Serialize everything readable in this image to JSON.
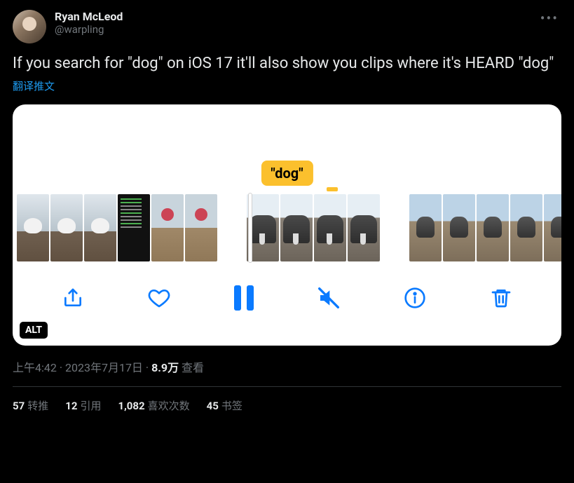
{
  "author": {
    "display_name": "Ryan McLeod",
    "handle": "@warpling"
  },
  "tweet_text": "If you search for \"dog\" on iOS 17 it'll also show you clips where it's HEARD \"dog\"",
  "translate_label": "翻译推文",
  "media": {
    "search_term_label": "\"dog\"",
    "alt_badge": "ALT"
  },
  "meta": {
    "time": "上午4:42",
    "date": "2023年7月17日",
    "views_count": "8.9万",
    "views_label": "查看"
  },
  "stats": {
    "retweets_count": "57",
    "retweets_label": "转推",
    "quotes_count": "12",
    "quotes_label": "引用",
    "likes_count": "1,082",
    "likes_label": "喜欢次数",
    "bookmarks_count": "45",
    "bookmarks_label": "书签"
  },
  "more_label": "•••"
}
